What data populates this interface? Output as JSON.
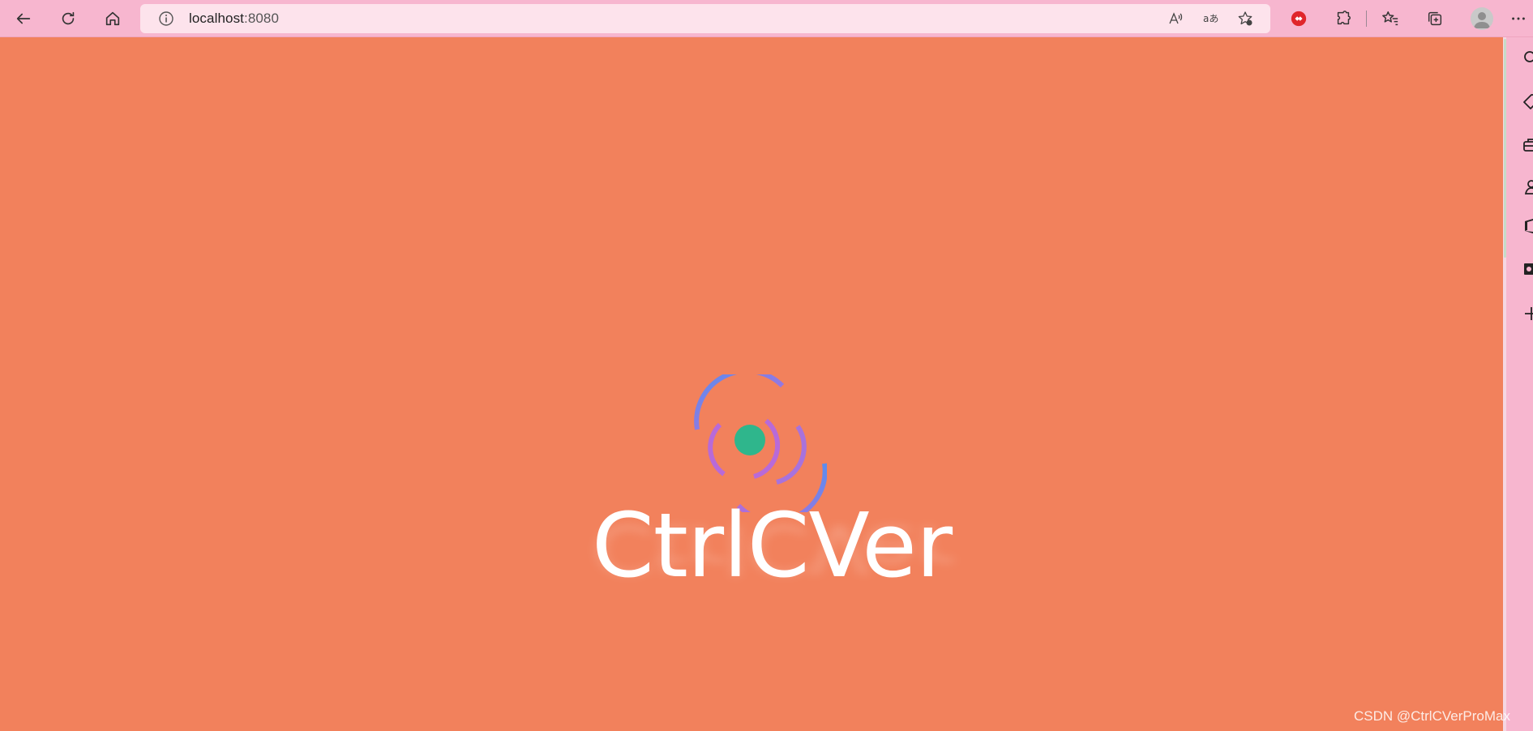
{
  "browser": {
    "url_host": "localhost",
    "url_port": ":8080",
    "colors": {
      "chrome": "#f7b6cf",
      "address_bar": "#fde3ec",
      "page_background": "#f2815c"
    }
  },
  "toolbar_icons": [
    "back-icon",
    "refresh-icon",
    "home-icon",
    "info-icon",
    "read-aloud-icon",
    "translate-icon",
    "add-favorite-icon",
    "extension-adblock-icon",
    "extensions-icon",
    "favorites-icon",
    "collections-icon",
    "profile-avatar",
    "more-icon"
  ],
  "page": {
    "brand_text": "CtrlCVer",
    "loader_colors": {
      "arc_blue": "#5b8def",
      "arc_purple": "#b86ad8",
      "dot": "#2fb68c"
    }
  },
  "watermark": "CSDN @CtrlCVerProMax"
}
